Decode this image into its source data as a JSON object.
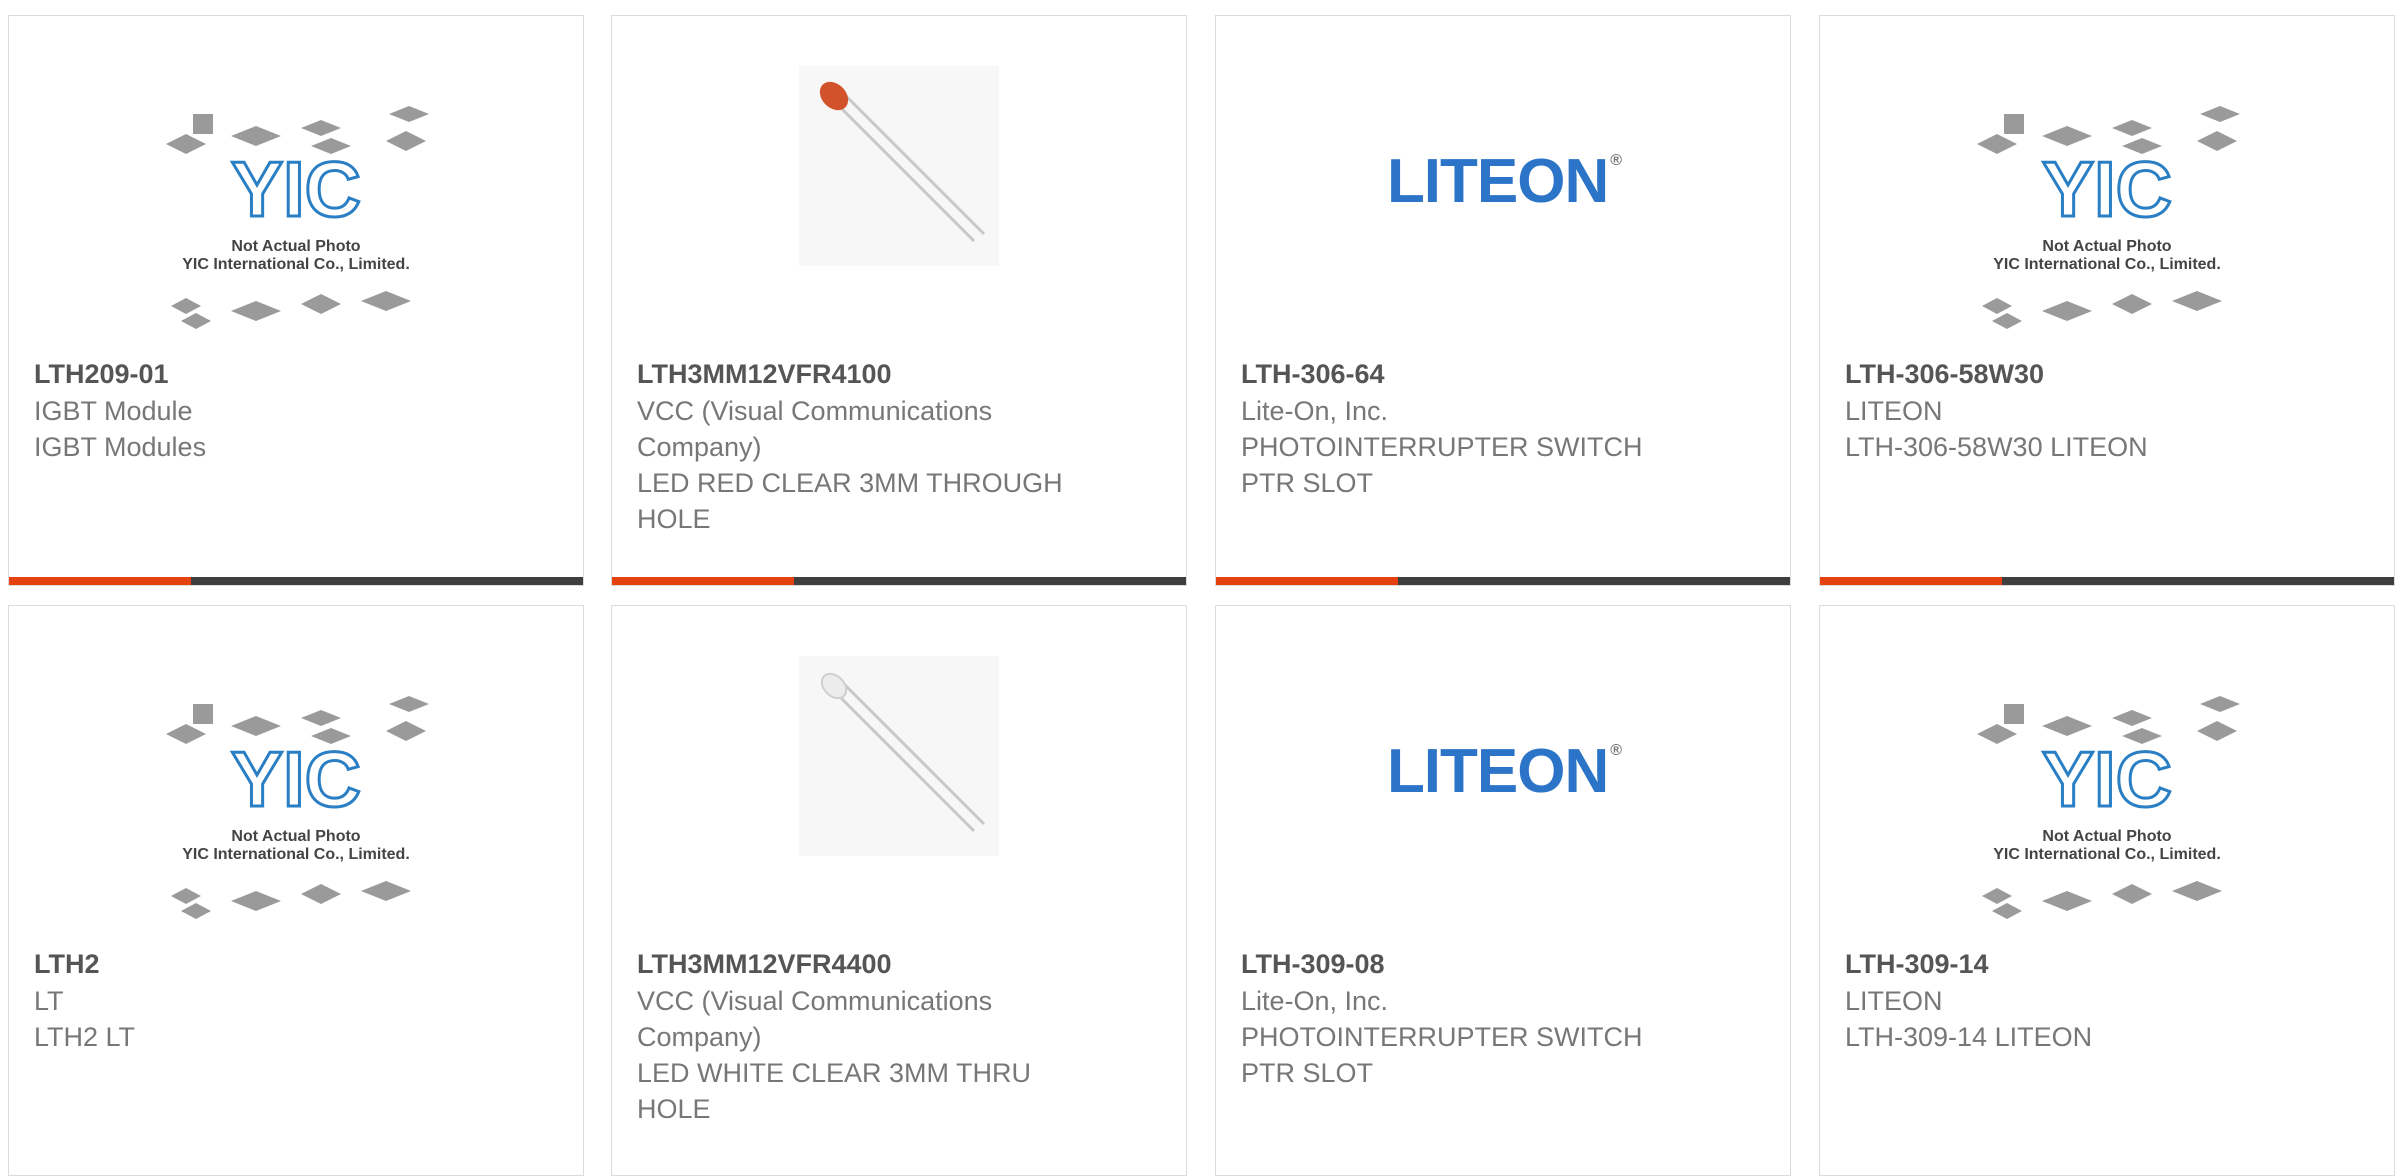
{
  "cards": [
    {
      "part": "LTH209-01",
      "manufacturer": "IGBT Module",
      "description": "IGBT Modules",
      "image": "yic-placeholder-icon",
      "placeholder_text": [
        "Not Actual Photo",
        "YIC International Co., Limited."
      ]
    },
    {
      "part": "LTH3MM12VFR4100",
      "manufacturer": "VCC (Visual Communications Company)",
      "description": "LED RED CLEAR 3MM THROUGH HOLE",
      "image": "red-led-icon"
    },
    {
      "part": "LTH-306-64",
      "manufacturer": "Lite-On, Inc.",
      "description": "PHOTOINTERRUPTER SWITCH PTR SLOT",
      "image": "liteon-logo",
      "logo_text": "LITEON"
    },
    {
      "part": "LTH-306-58W30",
      "manufacturer": "LITEON",
      "description": "LTH-306-58W30 LITEON",
      "image": "yic-placeholder-icon",
      "placeholder_text": [
        "Not Actual Photo",
        "YIC International Co., Limited."
      ]
    },
    {
      "part": "LTH2",
      "manufacturer": "LT",
      "description": "LTH2 LT",
      "image": "yic-placeholder-icon",
      "placeholder_text": [
        "Not Actual Photo",
        "YIC International Co., Limited."
      ]
    },
    {
      "part": "LTH3MM12VFR4400",
      "manufacturer": "VCC (Visual Communications Company)",
      "description": "LED WHITE CLEAR 3MM THRU HOLE",
      "image": "white-led-icon"
    },
    {
      "part": "LTH-309-08",
      "manufacturer": "Lite-On, Inc.",
      "description": "PHOTOINTERRUPTER SWITCH PTR SLOT",
      "image": "liteon-logo",
      "logo_text": "LITEON"
    },
    {
      "part": "LTH-309-14",
      "manufacturer": "LITEON",
      "description": "LTH-309-14 LITEON",
      "image": "yic-placeholder-icon",
      "placeholder_text": [
        "Not Actual Photo",
        "YIC International Co., Limited."
      ]
    }
  ],
  "colors": {
    "accent": "#e5400f",
    "bar": "#3e3e3e",
    "liteon_blue": "#2b74c7",
    "yic_blue": "#2a7fc4"
  }
}
